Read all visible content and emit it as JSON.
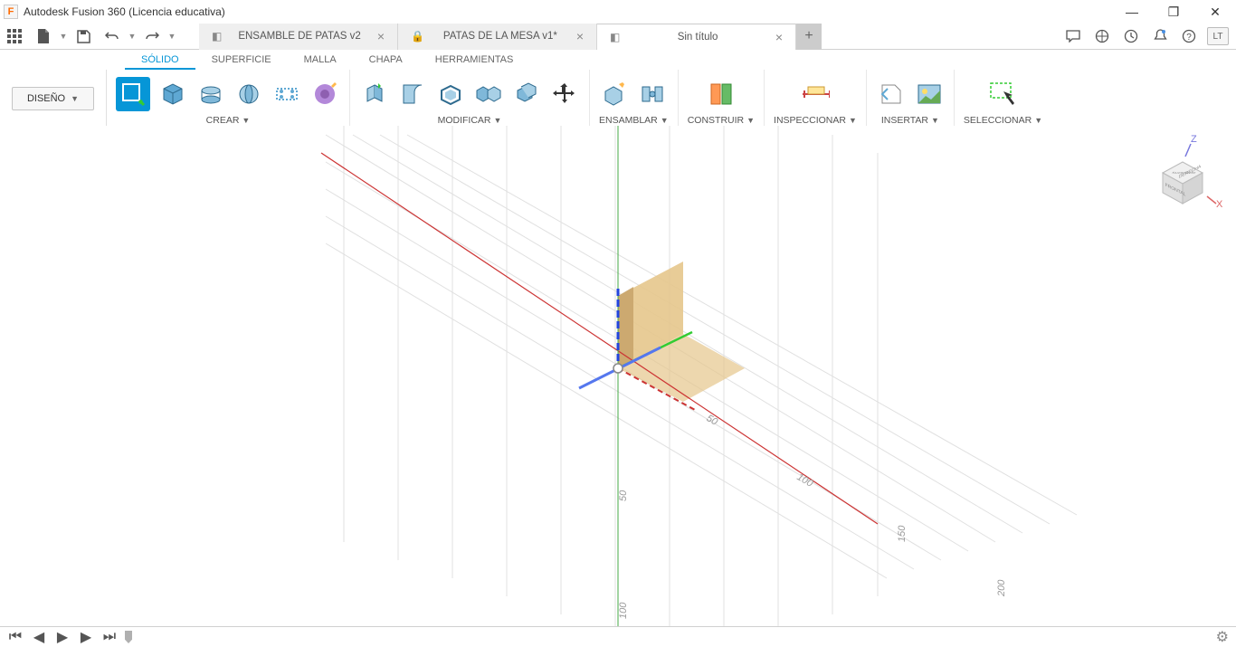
{
  "app": {
    "title": "Autodesk Fusion 360 (Licencia educativa)",
    "logo_letter": "F"
  },
  "tabs": [
    {
      "label": "ENSAMBLE DE PATAS v2",
      "locked": false
    },
    {
      "label": "PATAS DE LA MESA v1*",
      "locked": true
    },
    {
      "label": "Sin título",
      "locked": false
    }
  ],
  "avatar": "LT",
  "workspace": "DISEÑO",
  "ribbon_tabs": [
    "SÓLIDO",
    "SUPERFICIE",
    "MALLA",
    "CHAPA",
    "HERRAMIENTAS"
  ],
  "groups": {
    "crear": "CREAR",
    "modificar": "MODIFICAR",
    "ensamblar": "ENSAMBLAR",
    "construir": "CONSTRUIR",
    "inspeccionar": "INSPECCIONAR",
    "insertar": "INSERTAR",
    "seleccionar": "SELECCIONAR"
  },
  "rulers": {
    "x": [
      "50",
      "100",
      "150",
      "200"
    ],
    "y": [
      "50",
      "100"
    ]
  },
  "viewcube": {
    "axes": [
      "Z",
      "X"
    ],
    "face_top": "SUPERIOR",
    "face_right": "DERECHA",
    "face_front": "FRONTAL"
  }
}
